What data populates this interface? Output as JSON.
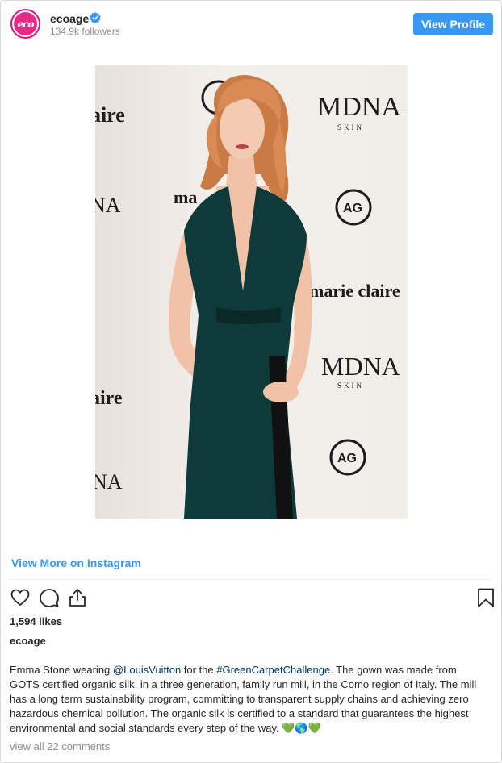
{
  "header": {
    "username": "ecoage",
    "avatar_text": "eco",
    "followers": "134.9k followers",
    "view_profile_label": "View Profile"
  },
  "photo": {
    "backdrop_logos": [
      "MDNA",
      "SKIN",
      "marie claire",
      "AG",
      "aire",
      "NA"
    ]
  },
  "view_more_label": "View More on Instagram",
  "actions": [
    "heart-icon",
    "comment-icon",
    "share-icon",
    "bookmark-icon"
  ],
  "likes": "1,594 likes",
  "owner": "ecoage",
  "caption": {
    "part1": "Emma Stone wearing ",
    "mention": "@LouisVuitton",
    "part2": " for the ",
    "hashtag": "#GreenCarpetChallenge",
    "part3": ". The gown was made from GOTS certified organic silk, in a three generation, family run mill, in the Como region of Italy. The mill has a long term sustainability program, committing to transparent supply chains and achieving zero hazardous chemical pollution. The organic silk is certified to a standard that guarantees the highest environmental and social standards every step of the way. ",
    "emoji": "💚🌎💚"
  },
  "comments_label": "view all 22 comments",
  "colors": {
    "accent": "#3897f0",
    "link": "#003569",
    "muted": "#8e8e8e",
    "dress": "#0f3a3a",
    "hair": "#d98a55"
  }
}
